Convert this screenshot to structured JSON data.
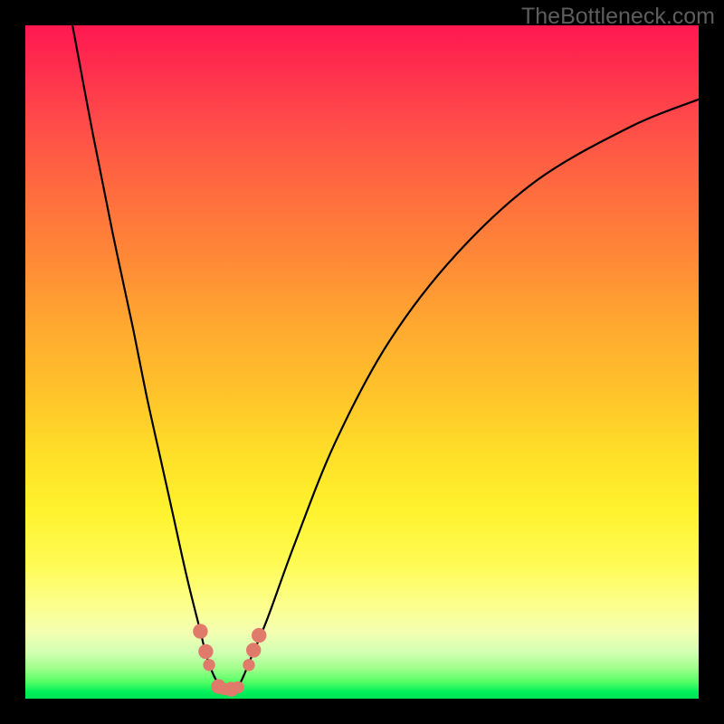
{
  "watermark": "TheBottleneck.com",
  "colors": {
    "background": "#000000",
    "gradient_top": "#ff1850",
    "gradient_bottom": "#00e356",
    "curve": "#000000",
    "marker": "#e07a6a"
  },
  "chart_data": {
    "type": "line",
    "title": "",
    "xlabel": "",
    "ylabel": "",
    "xlim": [
      0,
      100
    ],
    "ylim": [
      0,
      100
    ],
    "note": "No axis ticks or numeric labels are rendered in the image; values below are pixel-derived estimates of the V-shaped curve on a 0–100 × 0–100 normalized grid (y=0 at bottom).",
    "series": [
      {
        "name": "bottleneck-curve",
        "x": [
          7,
          10,
          13,
          16,
          18,
          20,
          22,
          24,
          26,
          27,
          28.5,
          30,
          31,
          32,
          33.5,
          36,
          40,
          46,
          54,
          64,
          76,
          90,
          100
        ],
        "y": [
          100,
          84,
          69,
          55,
          45,
          36,
          27,
          18,
          10,
          6,
          2.5,
          1.5,
          1.5,
          2.5,
          6,
          12,
          23,
          38,
          53,
          66,
          77,
          85,
          89
        ]
      }
    ],
    "markers": [
      {
        "x": 26.0,
        "y": 10.0,
        "r": 1.1
      },
      {
        "x": 26.8,
        "y": 7.0,
        "r": 1.1
      },
      {
        "x": 27.3,
        "y": 5.0,
        "r": 0.9
      },
      {
        "x": 28.7,
        "y": 1.8,
        "r": 1.1
      },
      {
        "x": 29.6,
        "y": 1.4,
        "r": 0.9
      },
      {
        "x": 30.6,
        "y": 1.4,
        "r": 1.1
      },
      {
        "x": 31.6,
        "y": 1.7,
        "r": 0.9
      },
      {
        "x": 33.2,
        "y": 5.0,
        "r": 0.9
      },
      {
        "x": 33.9,
        "y": 7.2,
        "r": 1.1
      },
      {
        "x": 34.7,
        "y": 9.4,
        "r": 1.1
      }
    ]
  }
}
